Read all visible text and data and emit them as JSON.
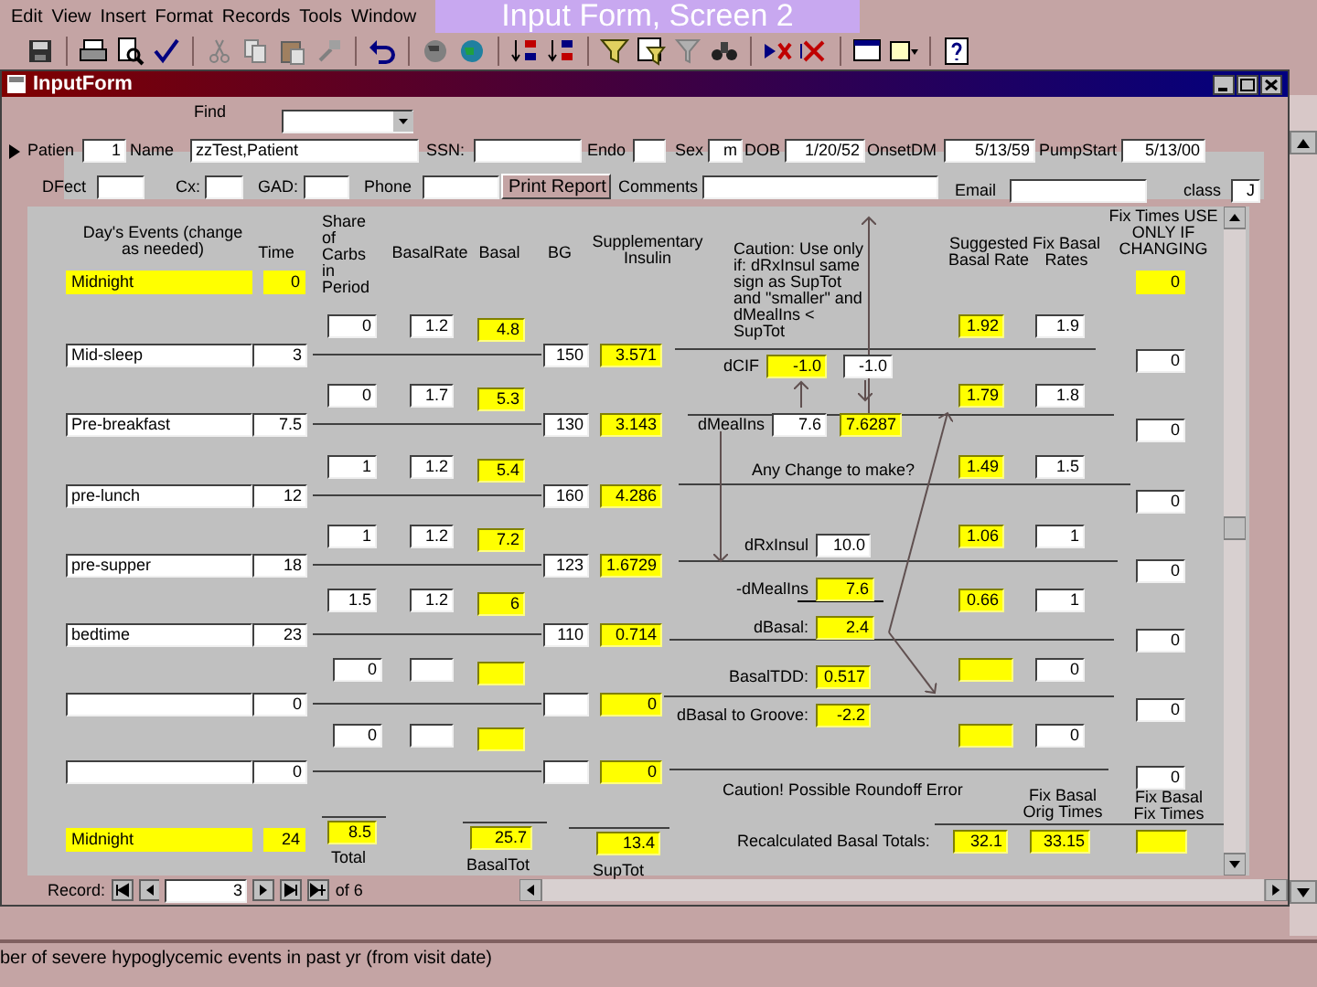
{
  "overlay_title": "Input Form, Screen 2",
  "menu": [
    "Edit",
    "View",
    "Insert",
    "Format",
    "Records",
    "Tools",
    "Window"
  ],
  "window": {
    "title": "InputForm"
  },
  "find": {
    "label": "Find"
  },
  "header_fields": [
    {
      "kind": "field",
      "label": "Patien",
      "value": "1"
    },
    {
      "kind": "field",
      "label": "Name",
      "value": "zzTest,Patient"
    },
    {
      "kind": "field",
      "label": "SSN:"
    },
    {
      "kind": "field",
      "label": "Endo"
    },
    {
      "kind": "field",
      "label": "Sex",
      "value": "m"
    },
    {
      "kind": "field",
      "label": "DOB",
      "value": "1/20/52"
    },
    {
      "kind": "field",
      "label": "OnsetDM",
      "value": "5/13/59"
    },
    {
      "kind": "field",
      "label": "PumpStart",
      "value": "5/13/00"
    },
    {
      "kind": "field",
      "label": "DFect"
    },
    {
      "kind": "field",
      "label": "Cx:"
    },
    {
      "kind": "field",
      "label": "GAD:"
    },
    {
      "kind": "field",
      "label": "Phone"
    },
    {
      "kind": "button",
      "label": "Print Report"
    },
    {
      "kind": "field",
      "label": "Comments"
    },
    {
      "kind": "field",
      "label": "Email"
    },
    {
      "kind": "field",
      "label": "class",
      "value": "J"
    }
  ],
  "column_headers": [
    "Day's Events (change as needed)",
    "Time",
    "Share of Carbs in Period",
    "BasalRate",
    "Basal",
    "BG",
    "Supplementary Insulin",
    "Caution: Use only if: dRxInsul same sign as SupTot and \"smaller\" and dMealIns < SupTot",
    "Suggested Basal Rate",
    "Fix Basal Rates",
    "Fix Times USE ONLY IF CHANGING"
  ],
  "events": [
    {
      "name": "Midnight",
      "time": "0",
      "locked": true,
      "fix_time": "0"
    },
    {
      "name": "Mid-sleep",
      "time": "3",
      "bg": "150",
      "supp_insulin": "3.571",
      "fix_time": "0",
      "locked": false
    },
    {
      "name": "Pre-breakfast",
      "time": "7.5",
      "bg": "130",
      "supp_insulin": "3.143",
      "fix_time": "0",
      "locked": false
    },
    {
      "name": "pre-lunch",
      "time": "12",
      "bg": "160",
      "supp_insulin": "4.286",
      "fix_time": "0",
      "locked": false
    },
    {
      "name": "pre-supper",
      "time": "18",
      "bg": "123",
      "supp_insulin": "1.6729",
      "fix_time": "0",
      "locked": false
    },
    {
      "name": "bedtime",
      "time": "23",
      "bg": "110",
      "supp_insulin": "0.714",
      "fix_time": "0",
      "locked": false
    },
    {
      "time": "0",
      "supp_insulin": "0",
      "fix_time": "0",
      "locked": false
    },
    {
      "time": "0",
      "supp_insulin": "0",
      "fix_time": "0",
      "locked": false
    },
    {
      "name": "Midnight",
      "time": "24",
      "locked": true
    }
  ],
  "periods": [
    {
      "share": "0",
      "basal_rate": "1.2",
      "basal": "4.8",
      "suggested": "1.92",
      "fix_basal": "1.9"
    },
    {
      "share": "0",
      "basal_rate": "1.7",
      "basal": "5.3",
      "suggested": "1.79",
      "fix_basal": "1.8"
    },
    {
      "share": "1",
      "basal_rate": "1.2",
      "basal": "5.4",
      "suggested": "1.49",
      "fix_basal": "1.5"
    },
    {
      "share": "1",
      "basal_rate": "1.2",
      "basal": "7.2",
      "suggested": "1.06",
      "fix_basal": "1"
    },
    {
      "share": "1.5",
      "basal_rate": "1.2",
      "basal": "6",
      "suggested": "0.66",
      "fix_basal": "1"
    },
    {
      "share": "0",
      "fix_basal": "0"
    },
    {
      "share": "0",
      "fix_basal": "0"
    }
  ],
  "totals": [
    {
      "label": "Total",
      "value": "8.5"
    },
    {
      "label": "BasalTot",
      "value": "25.7"
    },
    {
      "label": "SupTot",
      "value": "13.4"
    }
  ],
  "calc": [
    {
      "label": "dCIF",
      "values": [
        {
          "value": "-1.0",
          "computed": true
        },
        {
          "value": "-1.0",
          "computed": false
        }
      ]
    },
    {
      "label": "dMealIns",
      "values": [
        {
          "value": "7.6",
          "computed": false
        },
        {
          "value": "7.6287",
          "computed": true
        }
      ]
    },
    {
      "label": "dRxInsul",
      "values": [
        {
          "value": "10.0",
          "computed": false
        }
      ]
    },
    {
      "label": "-dMealIns",
      "values": [
        {
          "value": "7.6",
          "computed": true
        }
      ]
    },
    {
      "label": "dBasal:",
      "values": [
        {
          "value": "2.4",
          "computed": true
        }
      ]
    },
    {
      "label": "BasalTDD:",
      "values": [
        {
          "value": "0.517",
          "computed": true
        }
      ]
    },
    {
      "label": "dBasal to Groove:",
      "values": [
        {
          "value": "-2.2",
          "computed": true
        }
      ]
    }
  ],
  "notes": [
    "Any Change to make?",
    "Caution! Possible Roundoff Error"
  ],
  "recalc": {
    "label": "Recalculated Basal Totals:",
    "headers": [
      "Fix Basal Orig Times",
      "Fix Basal Fix Times"
    ],
    "values": [
      "32.1",
      "33.15"
    ]
  },
  "record_nav": {
    "label": "Record:",
    "current": "3",
    "count": "of 6"
  },
  "status_bar": "ber of severe hypoglycemic events in past yr (from visit date)"
}
